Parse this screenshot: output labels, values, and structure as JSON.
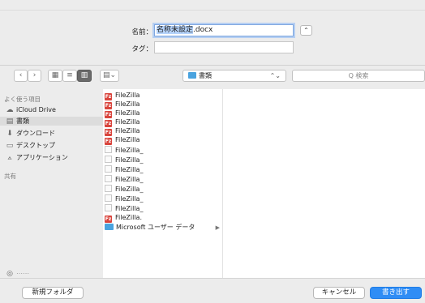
{
  "header": {
    "name_label": "名前：",
    "name_value_selected": "名称未設定",
    "name_value_ext": ".docx",
    "tag_label": "タグ：",
    "tag_value": "",
    "expand_glyph": "⌃"
  },
  "toolbar": {
    "back_glyph": "‹",
    "forward_glyph": "›",
    "view_icons_glyph": "▦",
    "view_list_glyph": "≡",
    "view_columns_glyph": "▥",
    "view_gallery_glyph": "▤⌄",
    "location": "書類",
    "location_arrows": "⌃⌄",
    "search_placeholder": "Q 検索"
  },
  "sidebar": {
    "favorites_header": "よく使う項目",
    "items": [
      {
        "label": "iCloud Drive",
        "icon": "cloud-icon",
        "glyph": "☁"
      },
      {
        "label": "書類",
        "icon": "document-icon",
        "glyph": "▤"
      },
      {
        "label": "ダウンロード",
        "icon": "download-icon",
        "glyph": "⬇"
      },
      {
        "label": "デスクトップ",
        "icon": "desktop-icon",
        "glyph": "▭"
      },
      {
        "label": "アプリケーション",
        "icon": "applications-icon",
        "glyph": "⟑"
      }
    ],
    "shared_header": "共有",
    "partial_item": "⋯⋯"
  },
  "files": [
    {
      "name": "FileZilla",
      "kind": "fz"
    },
    {
      "name": "FileZilla",
      "kind": "fz"
    },
    {
      "name": "FileZilla",
      "kind": "fz"
    },
    {
      "name": "FileZilla",
      "kind": "fz"
    },
    {
      "name": "FileZilla",
      "kind": "fz"
    },
    {
      "name": "FileZilla",
      "kind": "fz"
    },
    {
      "name": "FileZilla_",
      "kind": "doc"
    },
    {
      "name": "FileZilla_",
      "kind": "doc"
    },
    {
      "name": "FileZilla_",
      "kind": "doc"
    },
    {
      "name": "FileZilla_",
      "kind": "doc"
    },
    {
      "name": "FileZilla_",
      "kind": "doc"
    },
    {
      "name": "FileZilla_",
      "kind": "doc"
    },
    {
      "name": "FileZilla_",
      "kind": "doc"
    },
    {
      "name": "FileZilla.",
      "kind": "fz"
    },
    {
      "name": "Microsoft ユーザー データ",
      "kind": "folder"
    }
  ],
  "footer": {
    "new_folder": "新規フォルダ",
    "cancel": "キャンセル",
    "save": "書き出す"
  },
  "colors": {
    "accent": "#2f8df5",
    "filezilla_red": "#d9443c",
    "folder_blue": "#4aa3df"
  }
}
